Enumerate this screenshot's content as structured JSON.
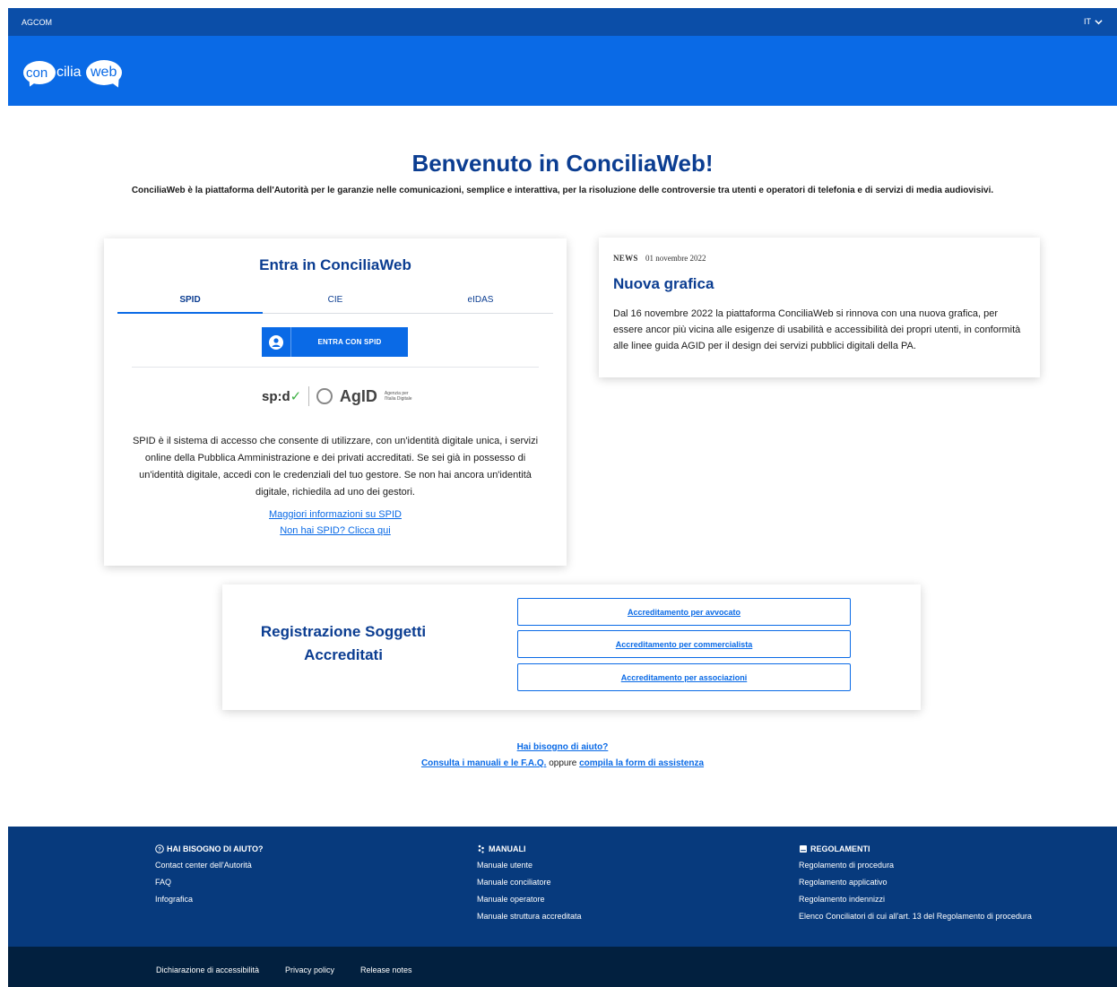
{
  "topbar": {
    "org": "AGCOM",
    "lang": "IT"
  },
  "logo": {
    "part1": "con",
    "part2": "cilia",
    "part3": "web"
  },
  "hero": {
    "title": "Benvenuto in ConciliaWeb!",
    "subtitle": "ConciliaWeb è la piattaforma dell'Autorità per le garanzie nelle comunicazioni, semplice e interattiva, per la risoluzione delle controversie tra utenti e operatori di telefonia e di servizi di media audiovisivi."
  },
  "login": {
    "title": "Entra in ConciliaWeb",
    "tabs": [
      {
        "label": "SPID"
      },
      {
        "label": "CIE"
      },
      {
        "label": "eIDAS"
      }
    ],
    "button_label": "ENTRA CON SPID",
    "brand_spid": "sp:d",
    "brand_agid": "AgID",
    "brand_agid_sub": "Agenzia per l'Italia Digitale",
    "description": "SPID è il sistema di accesso che consente di utilizzare, con un'identità digitale unica, i servizi online della Pubblica Amministrazione e dei privati accreditati. Se sei già in possesso di un'identità digitale, accedi con le credenziali del tuo gestore. Se non hai ancora un'identità digitale, richiedila ad uno dei gestori.",
    "link_more": "Maggiori informazioni su SPID",
    "link_noSpid": "Non hai SPID? Clicca qui"
  },
  "news": {
    "tag": "NEWS",
    "date": "01 novembre 2022",
    "title": "Nuova grafica",
    "text": "Dal 16 novembre 2022 la piattaforma ConciliaWeb si rinnova con una nuova grafica, per essere ancor più vicina alle esigenze di usabilità e accessibilità dei propri utenti, in conformità alle linee guida AGID per il design dei servizi pubblici digitali della PA."
  },
  "registration": {
    "title": "Registrazione Soggetti Accreditati",
    "buttons": [
      "Accreditamento per avvocato",
      "Accreditamento per commercialista",
      "Accreditamento per associazioni"
    ]
  },
  "help": {
    "question": "Hai bisogno di aiuto?",
    "manuals_link": "Consulta i manuali e le F.A.Q.",
    "or": "oppure",
    "form_link": "compila la form di assistenza"
  },
  "footer": {
    "help": {
      "heading": "HAI BISOGNO DI AIUTO?",
      "links": [
        "Contact center dell'Autorità",
        "FAQ",
        "Infografica"
      ]
    },
    "manuals": {
      "heading": "MANUALI",
      "links": [
        "Manuale utente",
        "Manuale conciliatore",
        "Manuale operatore",
        "Manuale struttura accreditata"
      ]
    },
    "rules": {
      "heading": "REGOLAMENTI",
      "links": [
        "Regolamento di procedura",
        "Regolamento applicativo",
        "Regolamento indennizzi",
        "Elenco Conciliatori di cui all'art. 13 del Regolamento di procedura"
      ]
    },
    "bottom": [
      "Dichiarazione di accessibilità",
      "Privacy policy",
      "Release notes"
    ]
  }
}
